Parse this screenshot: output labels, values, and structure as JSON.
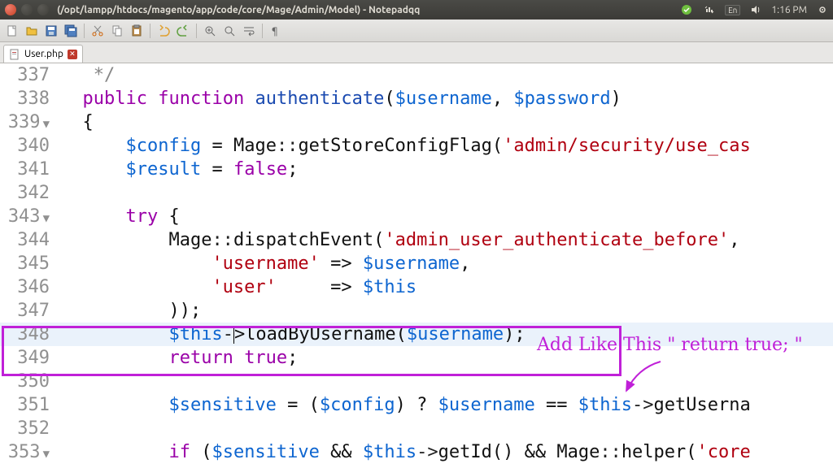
{
  "window": {
    "title": "(/opt/lampp/htdocs/magento/app/code/core/Mage/Admin/Model) - Notepadqq"
  },
  "tray": {
    "lang": "En",
    "time": "1:16 PM"
  },
  "tab": {
    "filename": "User.php"
  },
  "annotation": {
    "text": "Add Like This \" return true; \""
  },
  "code": {
    "lines": [
      {
        "n": "337",
        "fold": "",
        "tokens": [
          [
            "plain",
            "   "
          ],
          [
            "cmt",
            "*/"
          ]
        ]
      },
      {
        "n": "338",
        "fold": "",
        "tokens": [
          [
            "plain",
            "  "
          ],
          [
            "kw",
            "public"
          ],
          [
            "plain",
            " "
          ],
          [
            "kw",
            "function"
          ],
          [
            "plain",
            " "
          ],
          [
            "fn",
            "authenticate"
          ],
          [
            "plain",
            "("
          ],
          [
            "var",
            "$username"
          ],
          [
            "plain",
            ", "
          ],
          [
            "var",
            "$password"
          ],
          [
            "plain",
            ")"
          ]
        ]
      },
      {
        "n": "339",
        "fold": "▼",
        "tokens": [
          [
            "plain",
            "  {"
          ]
        ]
      },
      {
        "n": "340",
        "fold": "",
        "tokens": [
          [
            "plain",
            "      "
          ],
          [
            "var",
            "$config"
          ],
          [
            "plain",
            " = "
          ],
          [
            "plain",
            "Mage"
          ],
          [
            "op",
            "::"
          ],
          [
            "plain",
            "getStoreConfigFlag("
          ],
          [
            "str",
            "'admin/security/use_cas"
          ]
        ]
      },
      {
        "n": "341",
        "fold": "",
        "tokens": [
          [
            "plain",
            "      "
          ],
          [
            "var",
            "$result"
          ],
          [
            "plain",
            " = "
          ],
          [
            "bool",
            "false"
          ],
          [
            "plain",
            ";"
          ]
        ]
      },
      {
        "n": "342",
        "fold": "",
        "tokens": []
      },
      {
        "n": "343",
        "fold": "▼",
        "tokens": [
          [
            "plain",
            "      "
          ],
          [
            "kw",
            "try"
          ],
          [
            "plain",
            " {"
          ]
        ]
      },
      {
        "n": "344",
        "fold": "",
        "tokens": [
          [
            "plain",
            "          "
          ],
          [
            "plain",
            "Mage"
          ],
          [
            "op",
            "::"
          ],
          [
            "plain",
            "dispatchEvent("
          ],
          [
            "str",
            "'admin_user_authenticate_before'"
          ],
          [
            "plain",
            ","
          ]
        ]
      },
      {
        "n": "345",
        "fold": "",
        "tokens": [
          [
            "plain",
            "              "
          ],
          [
            "str",
            "'username'"
          ],
          [
            "plain",
            " => "
          ],
          [
            "var",
            "$username"
          ],
          [
            "plain",
            ","
          ]
        ]
      },
      {
        "n": "346",
        "fold": "",
        "tokens": [
          [
            "plain",
            "              "
          ],
          [
            "str",
            "'user'"
          ],
          [
            "plain",
            "     => "
          ],
          [
            "var",
            "$this"
          ]
        ]
      },
      {
        "n": "347",
        "fold": "",
        "tokens": [
          [
            "plain",
            "          ));"
          ]
        ]
      },
      {
        "n": "348",
        "fold": "",
        "cursor_after": 2,
        "current": true,
        "tokens": [
          [
            "plain",
            "          "
          ],
          [
            "var",
            "$this"
          ],
          [
            "op",
            "-"
          ],
          [
            "plain",
            ">loadByUsername("
          ],
          [
            "var",
            "$username"
          ],
          [
            "plain",
            ");"
          ]
        ]
      },
      {
        "n": "349",
        "fold": "",
        "tokens": [
          [
            "plain",
            "          "
          ],
          [
            "kw",
            "return"
          ],
          [
            "plain",
            " "
          ],
          [
            "bool",
            "true"
          ],
          [
            "plain",
            ";"
          ]
        ]
      },
      {
        "n": "350",
        "fold": "",
        "tokens": []
      },
      {
        "n": "351",
        "fold": "",
        "tokens": [
          [
            "plain",
            "          "
          ],
          [
            "var",
            "$sensitive"
          ],
          [
            "plain",
            " = ("
          ],
          [
            "var",
            "$config"
          ],
          [
            "plain",
            ") ? "
          ],
          [
            "var",
            "$username"
          ],
          [
            "plain",
            " == "
          ],
          [
            "var",
            "$this"
          ],
          [
            "op",
            "->"
          ],
          [
            "plain",
            "getUserna"
          ]
        ]
      },
      {
        "n": "352",
        "fold": "",
        "tokens": []
      },
      {
        "n": "353",
        "fold": "▼",
        "tokens": [
          [
            "plain",
            "          "
          ],
          [
            "kw",
            "if"
          ],
          [
            "plain",
            " ("
          ],
          [
            "var",
            "$sensitive"
          ],
          [
            "plain",
            " && "
          ],
          [
            "var",
            "$this"
          ],
          [
            "op",
            "->"
          ],
          [
            "plain",
            "getId() && "
          ],
          [
            "plain",
            "Mage"
          ],
          [
            "op",
            "::"
          ],
          [
            "plain",
            "helper("
          ],
          [
            "str",
            "'core"
          ]
        ]
      }
    ]
  }
}
